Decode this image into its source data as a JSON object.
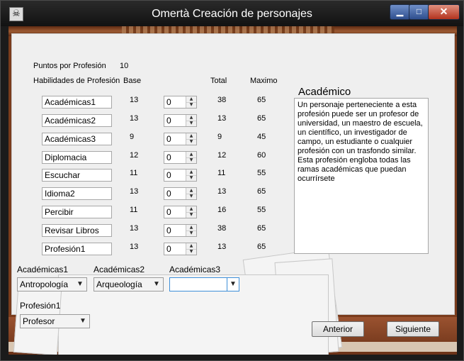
{
  "window": {
    "title": "Omertà Creación de personajes",
    "controls": {
      "minimize": "▁",
      "maximize": "□",
      "close": "✕"
    }
  },
  "labels": {
    "points_label": "Puntos por Profesión",
    "points_value": "10",
    "skills_header": "Habilidades de Profesión",
    "base_header": "Base",
    "total_header": "Total",
    "max_header": "Maximo"
  },
  "skills": [
    {
      "name": "Académicas1",
      "base": "13",
      "spin": "0",
      "total": "38",
      "max": "65"
    },
    {
      "name": "Académicas2",
      "base": "13",
      "spin": "0",
      "total": "13",
      "max": "65"
    },
    {
      "name": "Académicas3",
      "base": "9",
      "spin": "0",
      "total": "9",
      "max": "45"
    },
    {
      "name": "Diplomacia",
      "base": "12",
      "spin": "0",
      "total": "12",
      "max": "60"
    },
    {
      "name": "Escuchar",
      "base": "11",
      "spin": "0",
      "total": "11",
      "max": "55"
    },
    {
      "name": "Idioma2",
      "base": "13",
      "spin": "0",
      "total": "13",
      "max": "65"
    },
    {
      "name": "Percibir",
      "base": "11",
      "spin": "0",
      "total": "16",
      "max": "55"
    },
    {
      "name": "Revisar Libros",
      "base": "13",
      "spin": "0",
      "total": "38",
      "max": "65"
    },
    {
      "name": "Profesión1",
      "base": "13",
      "spin": "0",
      "total": "13",
      "max": "65"
    }
  ],
  "description": {
    "title": "Académico",
    "text": "Un personaje perteneciente a esta profesión puede ser un profesor de universidad, un maestro de escuela, un científico, un investigador de campo, un estudiante o cualquier profesión con un trasfondo similar. Esta profesión engloba todas las ramas académicas que puedan ocurrírsete"
  },
  "selects": {
    "academicas1": {
      "label": "Académicas1",
      "value": "Antropología"
    },
    "academicas2": {
      "label": "Académicas2",
      "value": "Arqueología"
    },
    "academicas3": {
      "label": "Académicas3",
      "value": ""
    },
    "profesion1": {
      "label": "Profesión1",
      "value": "Profesor"
    }
  },
  "buttons": {
    "back": "Anterior",
    "next": "Siguiente"
  },
  "icons": {
    "app": "skull-icon",
    "dropdown": "chevron-down-icon",
    "spin_up": "triangle-up-icon",
    "spin_down": "triangle-down-icon"
  }
}
